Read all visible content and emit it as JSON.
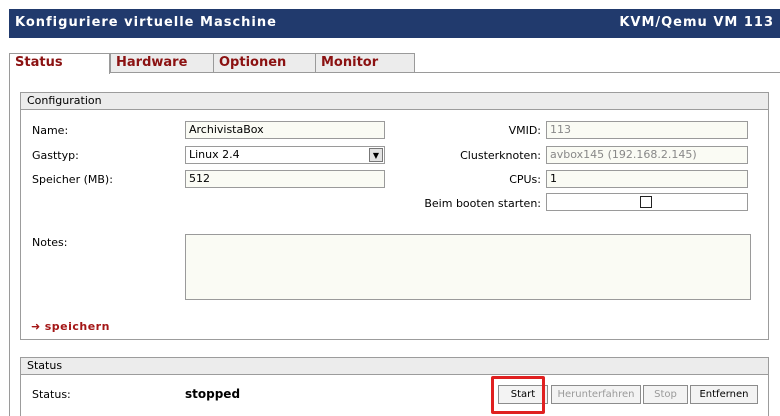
{
  "header": {
    "title": "Konfiguriere virtuelle Maschine",
    "vm_label": "KVM/Qemu VM 113"
  },
  "tabs": [
    {
      "label": "Status",
      "active": true
    },
    {
      "label": "Hardware",
      "active": false
    },
    {
      "label": "Optionen",
      "active": false
    },
    {
      "label": "Monitor",
      "active": false
    }
  ],
  "config": {
    "heading": "Configuration",
    "name_label": "Name:",
    "name_value": "ArchivistaBox",
    "gasttyp_label": "Gasttyp:",
    "gasttyp_value": "Linux 2.4",
    "speicher_label": "Speicher (MB):",
    "speicher_value": "512",
    "vmid_label": "VMID:",
    "vmid_value": "113",
    "cluster_label": "Clusterknoten:",
    "cluster_value": "avbox145 (192.168.2.145)",
    "cpus_label": "CPUs:",
    "cpus_value": "1",
    "boot_label": "Beim booten starten:",
    "boot_checked": false,
    "notes_label": "Notes:",
    "notes_value": "",
    "save_label": "speichern"
  },
  "status": {
    "heading": "Status",
    "status_label": "Status:",
    "status_value": "stopped",
    "buttons": {
      "start": "Start",
      "shutdown": "Herunterfahren",
      "stop": "Stop",
      "remove": "Entfernen"
    }
  },
  "colors": {
    "titlebar": "#213a6d",
    "tab_text": "#8b1212",
    "highlight": "#e02020"
  }
}
